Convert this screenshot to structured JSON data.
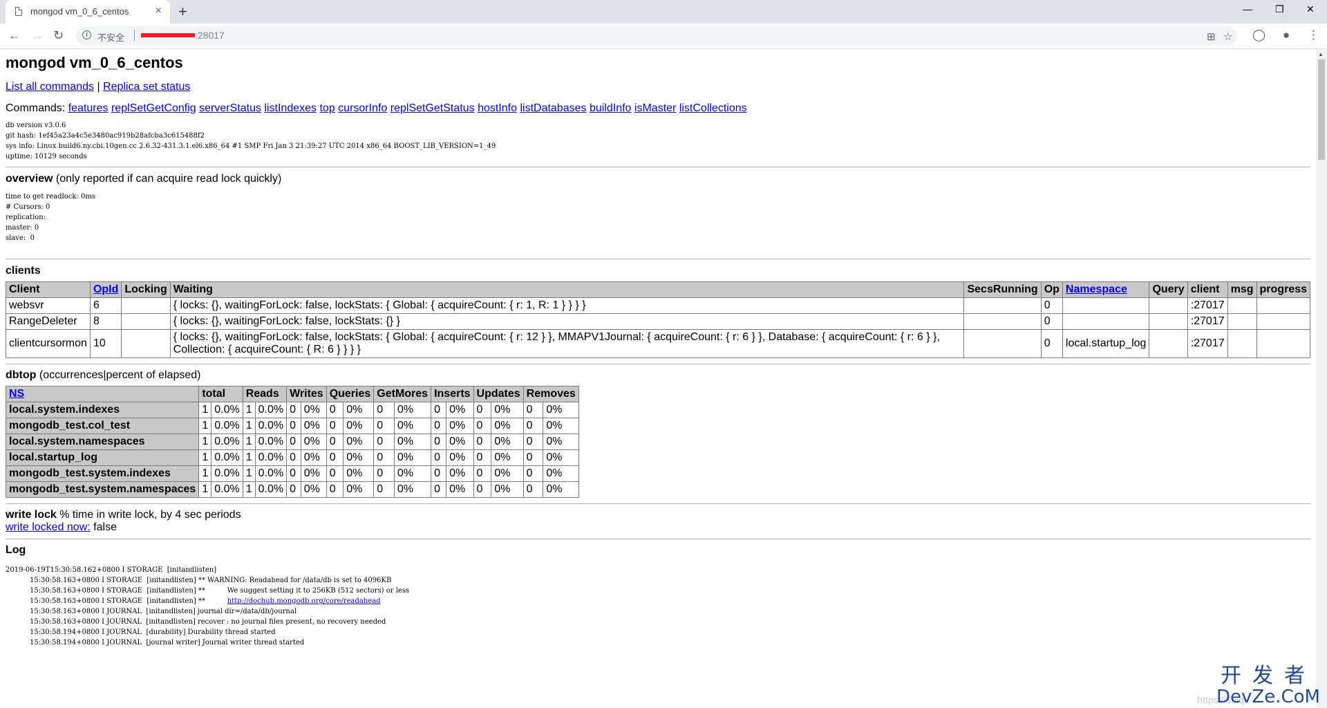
{
  "browser": {
    "tab_title": "mongod vm_0_6_centos",
    "tab_close": "×",
    "new_tab": "+",
    "win_minimize": "—",
    "win_restore": "❐",
    "win_close": "✕",
    "insecure_label": "不安全",
    "url_suffix": ":28017"
  },
  "page": {
    "title": "mongod vm_0_6_centos",
    "links": {
      "list_all_commands": "List all commands",
      "separator": " | ",
      "replica_set_status": "Replica set status"
    },
    "commands_label": "Commands: ",
    "commands": [
      "features",
      "replSetGetConfig",
      "serverStatus",
      "listIndexes",
      "top",
      "cursorInfo",
      "replSetGetStatus",
      "hostInfo",
      "listDatabases",
      "buildInfo",
      "isMaster",
      "listCollections"
    ],
    "sysinfo": [
      "db version v3.0.6",
      "git hash: 1ef45a23a4c5e3480ac919b28afcba3c615488f2",
      "sys info: Linux build6.ny.cbi.10gen.cc 2.6.32-431.3.1.el6.x86_64 #1 SMP Fri Jan 3 21:39:27 UTC 2014 x86_64 BOOST_LIB_VERSION=1_49",
      "uptime: 10129 seconds"
    ],
    "overview": {
      "heading": "overview",
      "note": " (only reported if can acquire read lock quickly)",
      "lines": [
        "time to get readlock: 0ms",
        "# Cursors: 0",
        "replication:",
        "master: 0",
        "slave:  0"
      ]
    },
    "clients": {
      "heading": "clients",
      "columns": [
        "Client",
        "OpId",
        "Locking",
        "Waiting",
        "SecsRunning",
        "Op",
        "Namespace",
        "Query",
        "client",
        "msg",
        "progress"
      ],
      "rows": [
        [
          "websvr",
          "6",
          "",
          "{ locks: {}, waitingForLock: false, lockStats: { Global: { acquireCount: { r: 1, R: 1 } } } }",
          "",
          "0",
          "",
          "",
          ":27017",
          "",
          ""
        ],
        [
          "RangeDeleter",
          "8",
          "",
          "{ locks: {}, waitingForLock: false, lockStats: {} }",
          "",
          "0",
          "",
          "",
          ":27017",
          "",
          ""
        ],
        [
          "clientcursormon",
          "10",
          "",
          "{ locks: {}, waitingForLock: false, lockStats: { Global: { acquireCount: { r: 12 } }, MMAPV1Journal: { acquireCount: { r: 6 } }, Database: { acquireCount: { r: 6 } }, Collection: { acquireCount: { R: 6 } } } }",
          "",
          "0",
          "local.startup_log",
          "",
          ":27017",
          "",
          ""
        ]
      ]
    },
    "dbtop": {
      "heading": "dbtop",
      "note": " (occurrences|percent of elapsed)",
      "columns": [
        "NS",
        "total",
        "Reads",
        "Writes",
        "Queries",
        "GetMores",
        "Inserts",
        "Updates",
        "Removes"
      ],
      "rows": [
        [
          "local.system.indexes",
          "1",
          "0.0%",
          "1",
          "0.0%",
          "0",
          "0%",
          "0",
          "0%",
          "0",
          "0%",
          "0",
          "0%",
          "0",
          "0%",
          "0",
          "0%"
        ],
        [
          "mongodb_test.col_test",
          "1",
          "0.0%",
          "1",
          "0.0%",
          "0",
          "0%",
          "0",
          "0%",
          "0",
          "0%",
          "0",
          "0%",
          "0",
          "0%",
          "0",
          "0%"
        ],
        [
          "local.system.namespaces",
          "1",
          "0.0%",
          "1",
          "0.0%",
          "0",
          "0%",
          "0",
          "0%",
          "0",
          "0%",
          "0",
          "0%",
          "0",
          "0%",
          "0",
          "0%"
        ],
        [
          "local.startup_log",
          "1",
          "0.0%",
          "1",
          "0.0%",
          "0",
          "0%",
          "0",
          "0%",
          "0",
          "0%",
          "0",
          "0%",
          "0",
          "0%",
          "0",
          "0%"
        ],
        [
          "mongodb_test.system.indexes",
          "1",
          "0.0%",
          "1",
          "0.0%",
          "0",
          "0%",
          "0",
          "0%",
          "0",
          "0%",
          "0",
          "0%",
          "0",
          "0%",
          "0",
          "0%"
        ],
        [
          "mongodb_test.system.namespaces",
          "1",
          "0.0%",
          "1",
          "0.0%",
          "0",
          "0%",
          "0",
          "0%",
          "0",
          "0%",
          "0",
          "0%",
          "0",
          "0%",
          "0",
          "0%"
        ]
      ]
    },
    "write_lock": {
      "heading": "write lock",
      "note": " % time in write lock, by 4 sec periods",
      "link": "write locked now:",
      "value": " false"
    },
    "log": {
      "heading": "Log",
      "lines": [
        "2019-06-19T15:30:58.162+0800 I STORAGE  [initandlisten]",
        "           15:30:58.163+0800 I STORAGE  [initandlisten] ** WARNING: Readahead for /data/db is set to 4096KB",
        "           15:30:58.163+0800 I STORAGE  [initandlisten] **          We suggest setting it to 256KB (512 sectors) or less",
        "           15:30:58.163+0800 I STORAGE  [initandlisten] **          ",
        "           15:30:58.163+0800 I JOURNAL  [initandlisten] journal dir=/data/db/journal",
        "           15:30:58.163+0800 I JOURNAL  [initandlisten] recover : no journal files present, no recovery needed",
        "           15:30:58.194+0800 I JOURNAL  [durability] Durability thread started",
        "           15:30:58.194+0800 I JOURNAL  [journal writer] Journal writer thread started"
      ],
      "readahead_link": "http://dochub.mongodb.org/core/readahead"
    },
    "watermark": {
      "cn": "开发者",
      "en": "DevZe.CoM",
      "faint": "https://shiq"
    }
  }
}
